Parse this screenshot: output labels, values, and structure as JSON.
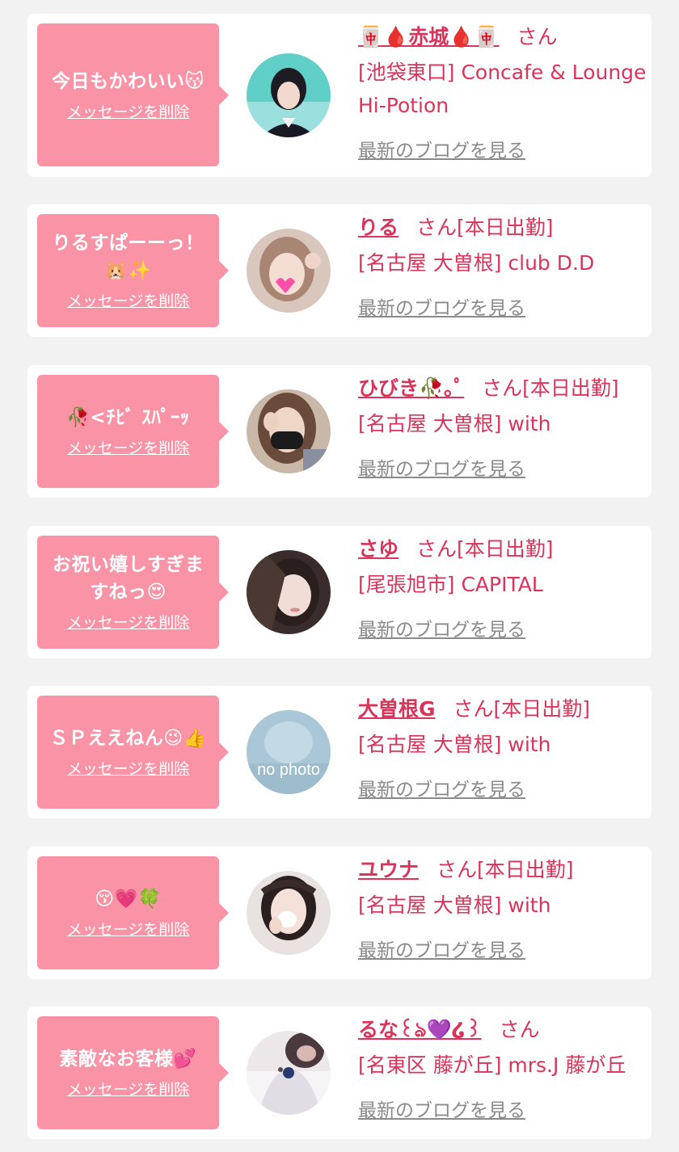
{
  "colors": {
    "background": "#f2f2f2",
    "card": "#ffffff",
    "bubble": "#fa93a6",
    "accent": "#d9345a",
    "muted": "#8a8a8a"
  },
  "labels": {
    "delete": "メッセージを削除",
    "san": "さん",
    "blog": "最新のブログを見る"
  },
  "messages": [
    {
      "message": "今日もかわいい😽",
      "name": "🀄🩸赤城🩸🀄",
      "status": "",
      "shop": "[池袋東口] Concafe & Lounge Hi-Potion",
      "avatar": "avatar-photo"
    },
    {
      "message": "りるすぱーーっ！🐹✨",
      "name": "りる",
      "status": "[本日出勤]",
      "shop": "[名古屋 大曽根] club D.D",
      "avatar": "avatar-photo"
    },
    {
      "message": "🥀<ﾁﾋﾞ ｽﾊﾟｰｯ",
      "name": "ひびき🥀｡ﾟ",
      "status": "[本日出勤]",
      "shop": "[名古屋 大曽根] with",
      "avatar": "avatar-photo"
    },
    {
      "message": "お祝い嬉しすぎますねっ😍",
      "name": "さゆ",
      "status": "[本日出勤]",
      "shop": "[尾張旭市] CAPITAL",
      "avatar": "avatar-photo"
    },
    {
      "message": "ＳＰええねん😉👍",
      "name": "大曽根G",
      "status": "[本日出勤]",
      "shop": "[名古屋 大曽根] with",
      "avatar": "no-photo-placeholder",
      "avatar_text": "no photo"
    },
    {
      "message": "😚💗🍀",
      "name": "ユウナ",
      "status": "[本日出勤]",
      "shop": "[名古屋 大曽根] with",
      "avatar": "avatar-photo"
    },
    {
      "message": "素敵なお客様💕",
      "name": "るな꒰ঌ💜໒꒱",
      "status": "",
      "shop": "[名東区 藤が丘] mrs.J 藤が丘",
      "avatar": "avatar-photo"
    }
  ]
}
